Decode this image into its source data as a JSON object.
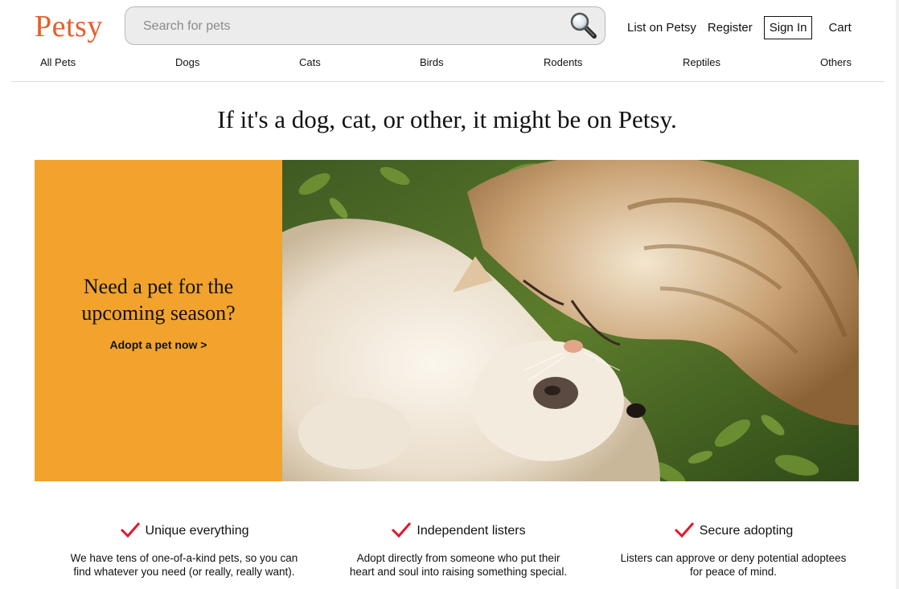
{
  "brand": {
    "name": "Petsy",
    "color": "#e85d2a"
  },
  "search": {
    "placeholder": "Search for pets",
    "icon": "magnifier-icon"
  },
  "top_links": {
    "list": "List on Petsy",
    "register": "Register",
    "signin": "Sign In",
    "cart": "Cart"
  },
  "categories": [
    "All Pets",
    "Dogs",
    "Cats",
    "Birds",
    "Rodents",
    "Reptiles",
    "Others"
  ],
  "tagline": "If it's a dog, cat, or other, it might be on Petsy.",
  "hero": {
    "heading_line1": "Need a pet for the",
    "heading_line2": "upcoming season?",
    "cta": "Adopt a pet now >",
    "accent_color": "#f1a32e"
  },
  "features": [
    {
      "title": "Unique everything",
      "desc_line1": "We have tens of one-of-a-kind pets, so you can",
      "desc_line2": "find whatever you need (or really, really want)."
    },
    {
      "title": "Independent listers",
      "desc_line1": "Adopt directly from someone who put their",
      "desc_line2": "heart and soul into raising something special."
    },
    {
      "title": "Secure adopting",
      "desc_line1": "Listers can approve or deny potential adoptees",
      "desc_line2": "for peace of mind."
    }
  ],
  "check_color": "#e0182d"
}
